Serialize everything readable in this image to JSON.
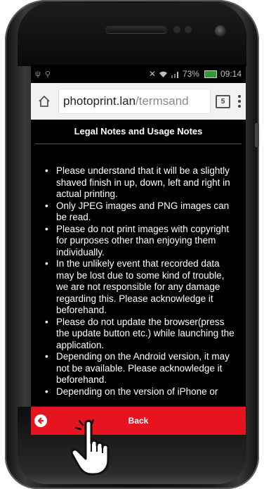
{
  "status_bar": {
    "battery_text": "73%",
    "time": "09:14",
    "left_icons": [
      "usb-icon",
      "location-icon"
    ],
    "right_icons": [
      "mute-icon",
      "wifi-icon",
      "signal-icon",
      "battery-icon"
    ]
  },
  "browser": {
    "url_host": "photoprint.lan",
    "url_path": "/termsand",
    "tab_count": "5"
  },
  "page": {
    "title": "Legal Notes and Usage Notes",
    "notes": [
      "Please understand that it will be a slightly shaved finish in up, down, left and right in actual printing.",
      "Only JPEG images and PNG images can be read.",
      "Please do not print images with copyright for purposes other than enjoying them individually.",
      "In the unlikely event that recorded data may be lost due to some kind of trouble, we are not responsible for any damage regarding this. Please acknowledge it beforehand.",
      "Please do not update the browser(press the update button etc.) while launching the application.",
      "Depending on the Android version, it may not be available. Please acknowledge it beforehand.",
      "Depending on the version of iPhone or"
    ]
  },
  "footer": {
    "back_label": "Back",
    "accent_color": "#e6141e"
  }
}
